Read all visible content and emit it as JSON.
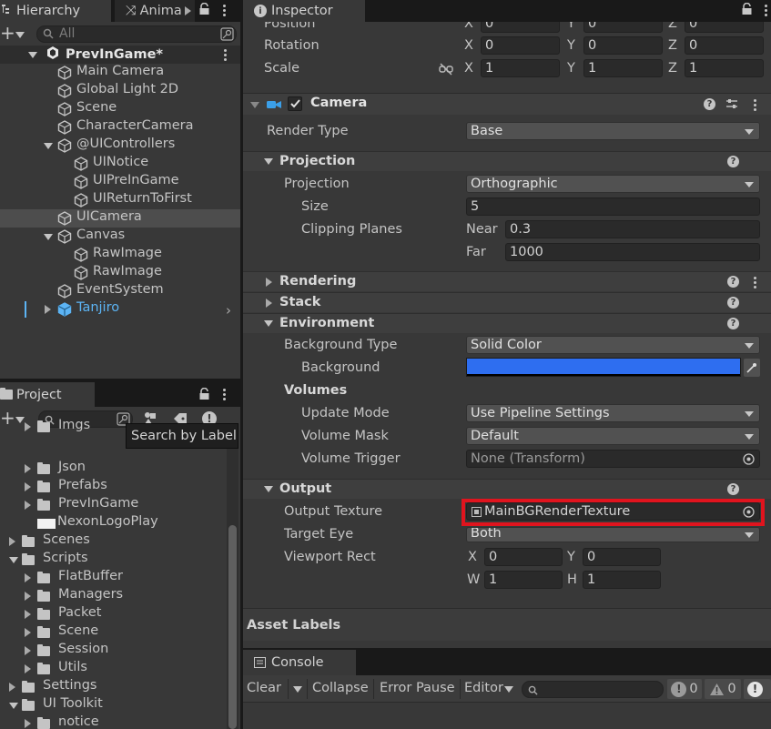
{
  "hierarchy": {
    "tabs": [
      {
        "label": "Hierarchy"
      },
      {
        "label": "Anima"
      }
    ],
    "search_placeholder": "All",
    "scene": "PrevInGame*",
    "items": [
      {
        "label": "Main Camera"
      },
      {
        "label": "Global Light 2D"
      },
      {
        "label": "Scene"
      },
      {
        "label": "CharacterCamera"
      },
      {
        "label": "@UIControllers"
      },
      {
        "label": "UINotice"
      },
      {
        "label": "UIPreInGame"
      },
      {
        "label": "UIReturnToFirst"
      },
      {
        "label": "UICamera"
      },
      {
        "label": "Canvas"
      },
      {
        "label": "RawImage"
      },
      {
        "label": "RawImage"
      },
      {
        "label": "EventSystem"
      },
      {
        "label": "Tanjiro"
      }
    ]
  },
  "project": {
    "tab": "Project",
    "tooltip": "Search by Label",
    "items": [
      {
        "label": "Imgs"
      },
      {
        "label": "Json"
      },
      {
        "label": "Prefabs"
      },
      {
        "label": "PrevInGame"
      },
      {
        "label": "NexonLogoPlay"
      },
      {
        "label": "Scenes"
      },
      {
        "label": "Scripts"
      },
      {
        "label": "FlatBuffer"
      },
      {
        "label": "Managers"
      },
      {
        "label": "Packet"
      },
      {
        "label": "Scene"
      },
      {
        "label": "Session"
      },
      {
        "label": "Utils"
      },
      {
        "label": "Settings"
      },
      {
        "label": "UI Toolkit"
      },
      {
        "label": "notice"
      },
      {
        "label": "PrevInGame"
      }
    ]
  },
  "inspector": {
    "tab": "Inspector",
    "transform": {
      "position_label": "Position",
      "rotation_label": "Rotation",
      "scale_label": "Scale",
      "axis_x": "X",
      "axis_y": "Y",
      "axis_z": "Z",
      "position": [
        "0",
        "0",
        "0"
      ],
      "rotation": [
        "0",
        "0",
        "0"
      ],
      "scale": [
        "1",
        "1",
        "1"
      ]
    },
    "camera": {
      "title": "Camera",
      "render_type_label": "Render Type",
      "render_type": "Base",
      "projection_header": "Projection",
      "projection_label": "Projection",
      "projection": "Orthographic",
      "size_label": "Size",
      "size": "5",
      "clipping_label": "Clipping Planes",
      "near_label": "Near",
      "near": "0.3",
      "far_label": "Far",
      "far": "1000",
      "rendering_header": "Rendering",
      "stack_header": "Stack",
      "environment_header": "Environment",
      "bg_type_label": "Background Type",
      "bg_type": "Solid Color",
      "background_label": "Background",
      "background_color": "#2e6ef0",
      "volumes_label": "Volumes",
      "update_mode_label": "Update Mode",
      "update_mode": "Use Pipeline Settings",
      "volume_mask_label": "Volume Mask",
      "volume_mask": "Default",
      "volume_trigger_label": "Volume Trigger",
      "volume_trigger": "None (Transform)",
      "output_header": "Output",
      "output_texture_label": "Output Texture",
      "output_texture": "MainBGRenderTexture",
      "target_eye_label": "Target Eye",
      "target_eye": "Both",
      "viewport_label": "Viewport Rect",
      "vp_x_label": "X",
      "vp_x": "0",
      "vp_y_label": "Y",
      "vp_y": "0",
      "vp_w_label": "W",
      "vp_w": "1",
      "vp_h_label": "H",
      "vp_h": "1"
    },
    "asset_labels": "Asset Labels"
  },
  "console": {
    "tab": "Console",
    "clear": "Clear",
    "collapse": "Collapse",
    "error_pause": "Error Pause",
    "editor": "Editor",
    "log_count": "0",
    "warn_count": "0"
  },
  "colors": {
    "highlight": "#e0141e",
    "prefab": "#5cb4f4",
    "selection": "#4d4d4d"
  }
}
